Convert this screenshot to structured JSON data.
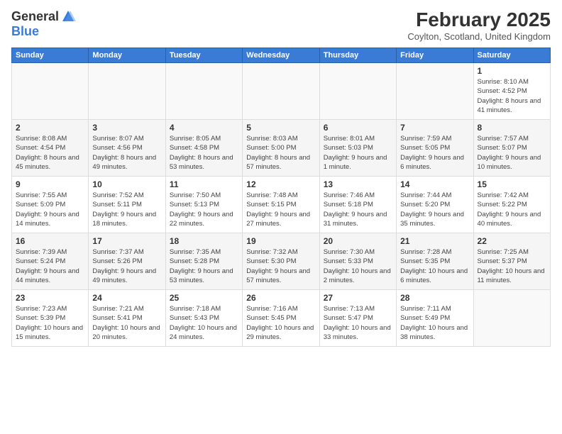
{
  "logo": {
    "general": "General",
    "blue": "Blue"
  },
  "title": "February 2025",
  "location": "Coylton, Scotland, United Kingdom",
  "weekdays": [
    "Sunday",
    "Monday",
    "Tuesday",
    "Wednesday",
    "Thursday",
    "Friday",
    "Saturday"
  ],
  "weeks": [
    [
      {
        "day": null
      },
      {
        "day": null
      },
      {
        "day": null
      },
      {
        "day": null
      },
      {
        "day": null
      },
      {
        "day": null
      },
      {
        "day": 1,
        "sunrise": "8:10 AM",
        "sunset": "4:52 PM",
        "daylight": "8 hours and 41 minutes."
      }
    ],
    [
      {
        "day": 2,
        "sunrise": "8:08 AM",
        "sunset": "4:54 PM",
        "daylight": "8 hours and 45 minutes."
      },
      {
        "day": 3,
        "sunrise": "8:07 AM",
        "sunset": "4:56 PM",
        "daylight": "8 hours and 49 minutes."
      },
      {
        "day": 4,
        "sunrise": "8:05 AM",
        "sunset": "4:58 PM",
        "daylight": "8 hours and 53 minutes."
      },
      {
        "day": 5,
        "sunrise": "8:03 AM",
        "sunset": "5:00 PM",
        "daylight": "8 hours and 57 minutes."
      },
      {
        "day": 6,
        "sunrise": "8:01 AM",
        "sunset": "5:03 PM",
        "daylight": "9 hours and 1 minute."
      },
      {
        "day": 7,
        "sunrise": "7:59 AM",
        "sunset": "5:05 PM",
        "daylight": "9 hours and 6 minutes."
      },
      {
        "day": 8,
        "sunrise": "7:57 AM",
        "sunset": "5:07 PM",
        "daylight": "9 hours and 10 minutes."
      }
    ],
    [
      {
        "day": 9,
        "sunrise": "7:55 AM",
        "sunset": "5:09 PM",
        "daylight": "9 hours and 14 minutes."
      },
      {
        "day": 10,
        "sunrise": "7:52 AM",
        "sunset": "5:11 PM",
        "daylight": "9 hours and 18 minutes."
      },
      {
        "day": 11,
        "sunrise": "7:50 AM",
        "sunset": "5:13 PM",
        "daylight": "9 hours and 22 minutes."
      },
      {
        "day": 12,
        "sunrise": "7:48 AM",
        "sunset": "5:15 PM",
        "daylight": "9 hours and 27 minutes."
      },
      {
        "day": 13,
        "sunrise": "7:46 AM",
        "sunset": "5:18 PM",
        "daylight": "9 hours and 31 minutes."
      },
      {
        "day": 14,
        "sunrise": "7:44 AM",
        "sunset": "5:20 PM",
        "daylight": "9 hours and 35 minutes."
      },
      {
        "day": 15,
        "sunrise": "7:42 AM",
        "sunset": "5:22 PM",
        "daylight": "9 hours and 40 minutes."
      }
    ],
    [
      {
        "day": 16,
        "sunrise": "7:39 AM",
        "sunset": "5:24 PM",
        "daylight": "9 hours and 44 minutes."
      },
      {
        "day": 17,
        "sunrise": "7:37 AM",
        "sunset": "5:26 PM",
        "daylight": "9 hours and 49 minutes."
      },
      {
        "day": 18,
        "sunrise": "7:35 AM",
        "sunset": "5:28 PM",
        "daylight": "9 hours and 53 minutes."
      },
      {
        "day": 19,
        "sunrise": "7:32 AM",
        "sunset": "5:30 PM",
        "daylight": "9 hours and 57 minutes."
      },
      {
        "day": 20,
        "sunrise": "7:30 AM",
        "sunset": "5:33 PM",
        "daylight": "10 hours and 2 minutes."
      },
      {
        "day": 21,
        "sunrise": "7:28 AM",
        "sunset": "5:35 PM",
        "daylight": "10 hours and 6 minutes."
      },
      {
        "day": 22,
        "sunrise": "7:25 AM",
        "sunset": "5:37 PM",
        "daylight": "10 hours and 11 minutes."
      }
    ],
    [
      {
        "day": 23,
        "sunrise": "7:23 AM",
        "sunset": "5:39 PM",
        "daylight": "10 hours and 15 minutes."
      },
      {
        "day": 24,
        "sunrise": "7:21 AM",
        "sunset": "5:41 PM",
        "daylight": "10 hours and 20 minutes."
      },
      {
        "day": 25,
        "sunrise": "7:18 AM",
        "sunset": "5:43 PM",
        "daylight": "10 hours and 24 minutes."
      },
      {
        "day": 26,
        "sunrise": "7:16 AM",
        "sunset": "5:45 PM",
        "daylight": "10 hours and 29 minutes."
      },
      {
        "day": 27,
        "sunrise": "7:13 AM",
        "sunset": "5:47 PM",
        "daylight": "10 hours and 33 minutes."
      },
      {
        "day": 28,
        "sunrise": "7:11 AM",
        "sunset": "5:49 PM",
        "daylight": "10 hours and 38 minutes."
      },
      {
        "day": null
      }
    ]
  ]
}
